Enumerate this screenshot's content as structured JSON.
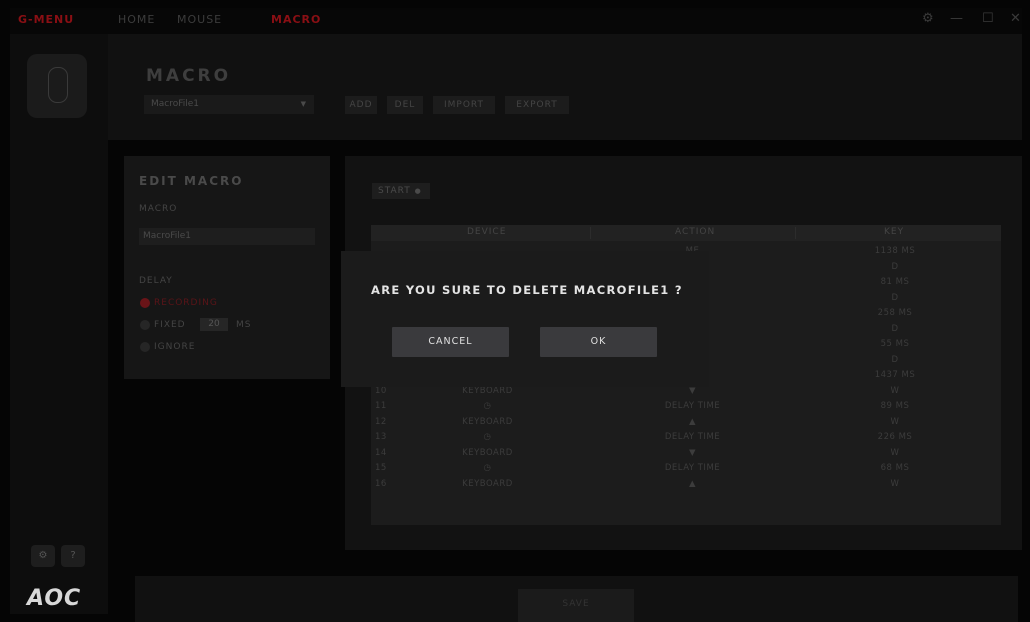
{
  "titlebar": {
    "app_name": "G-MENU",
    "nav": [
      "HOME",
      "MOUSE",
      "MACRO"
    ],
    "settings_glyph": "⚙",
    "minimize_glyph": "—",
    "maximize_glyph": "☐",
    "close_glyph": "✕"
  },
  "sidebar": {
    "btn1": "⚙",
    "btn2": "?",
    "brand": "AOC"
  },
  "header": {
    "title": "MACRO",
    "selected_file": "MacroFile1",
    "buttons": [
      "ADD",
      "DEL",
      "IMPORT",
      "EXPORT"
    ]
  },
  "edit_macro": {
    "title": "EDIT MACRO",
    "macro_label": "MACRO",
    "macro_name": "MacroFile1",
    "delay_label": "DELAY",
    "recording": "RECORDING",
    "fixed": "FIXED",
    "fixed_value": "20",
    "ms": "MS",
    "ignore": "IGNORE"
  },
  "list": {
    "start_label": "START",
    "headers": [
      "DEVICE",
      "ACTION",
      "KEY"
    ],
    "rows": [
      {
        "n": "",
        "device": "",
        "action": "ME",
        "key": "1138 MS"
      },
      {
        "n": "",
        "device": "",
        "action": "",
        "key": "D"
      },
      {
        "n": "",
        "device": "",
        "action": "ME",
        "key": "81 MS"
      },
      {
        "n": "",
        "device": "",
        "action": "",
        "key": "D"
      },
      {
        "n": "",
        "device": "",
        "action": "ME",
        "key": "258 MS"
      },
      {
        "n": "",
        "device": "",
        "action": "",
        "key": "D"
      },
      {
        "n": "",
        "device": "",
        "action": "ME",
        "key": "55 MS"
      },
      {
        "n": "",
        "device": "",
        "action": "",
        "key": "D"
      },
      {
        "n": "",
        "device": "",
        "action": "ME",
        "key": "1437 MS"
      },
      {
        "n": "10",
        "device": "KEYBOARD",
        "action": "▼",
        "key": "W"
      },
      {
        "n": "11",
        "device": "◷",
        "action": "DELAY TIME",
        "key": "89 MS"
      },
      {
        "n": "12",
        "device": "KEYBOARD",
        "action": "▲",
        "key": "W"
      },
      {
        "n": "13",
        "device": "◷",
        "action": "DELAY TIME",
        "key": "226 MS"
      },
      {
        "n": "14",
        "device": "KEYBOARD",
        "action": "▼",
        "key": "W"
      },
      {
        "n": "15",
        "device": "◷",
        "action": "DELAY TIME",
        "key": "68 MS"
      },
      {
        "n": "16",
        "device": "KEYBOARD",
        "action": "▲",
        "key": "W"
      }
    ]
  },
  "footer": {
    "save": "SAVE"
  },
  "dialog": {
    "message": "ARE YOU SURE TO DELETE MACROFILE1 ?",
    "cancel": "CANCEL",
    "ok": "OK"
  },
  "colors": {
    "accent": "#8a0f14",
    "dialog_bg": "#1b1b1b",
    "dialog_button": "#3a3a3d"
  }
}
